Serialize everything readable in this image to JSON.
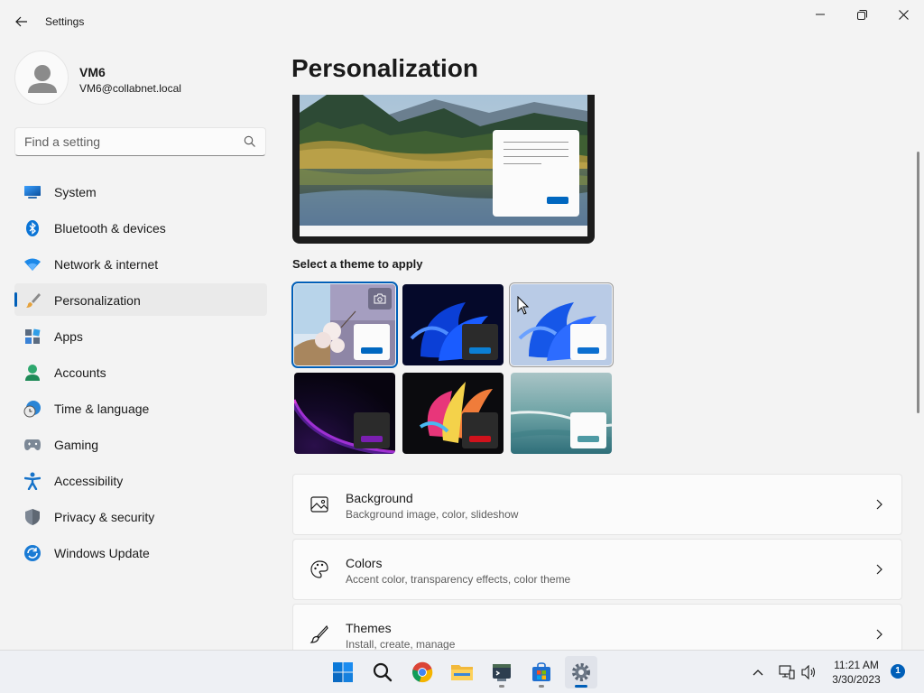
{
  "window": {
    "title": "Settings"
  },
  "user": {
    "name": "VM6",
    "email": "VM6@collabnet.local"
  },
  "search": {
    "placeholder": "Find a setting"
  },
  "nav": {
    "items": [
      {
        "label": "System",
        "icon": "monitor-icon"
      },
      {
        "label": "Bluetooth & devices",
        "icon": "bluetooth-icon"
      },
      {
        "label": "Network & internet",
        "icon": "wifi-icon"
      },
      {
        "label": "Personalization",
        "icon": "brush-icon",
        "active": true
      },
      {
        "label": "Apps",
        "icon": "apps-icon"
      },
      {
        "label": "Accounts",
        "icon": "person-icon"
      },
      {
        "label": "Time & language",
        "icon": "clock-globe-icon"
      },
      {
        "label": "Gaming",
        "icon": "controller-icon"
      },
      {
        "label": "Accessibility",
        "icon": "accessibility-icon"
      },
      {
        "label": "Privacy & security",
        "icon": "shield-icon"
      },
      {
        "label": "Windows Update",
        "icon": "update-icon"
      }
    ]
  },
  "main": {
    "title": "Personalization",
    "theme_caption": "Select a theme to apply",
    "cards": [
      {
        "title": "Background",
        "subtitle": "Background image, color, slideshow",
        "icon": "picture-icon"
      },
      {
        "title": "Colors",
        "subtitle": "Accent color, transparency effects, color theme",
        "icon": "palette-icon"
      },
      {
        "title": "Themes",
        "subtitle": "Install, create, manage",
        "icon": "brush-icon"
      }
    ]
  },
  "taskbar": {
    "time": "11:21 AM",
    "date": "3/30/2023",
    "notifications": "1",
    "apps": [
      "start-icon",
      "search-icon",
      "chrome-icon",
      "file-explorer-icon",
      "terminal-icon",
      "store-icon",
      "settings-icon"
    ]
  },
  "colors": {
    "accent": "#005fb8"
  }
}
